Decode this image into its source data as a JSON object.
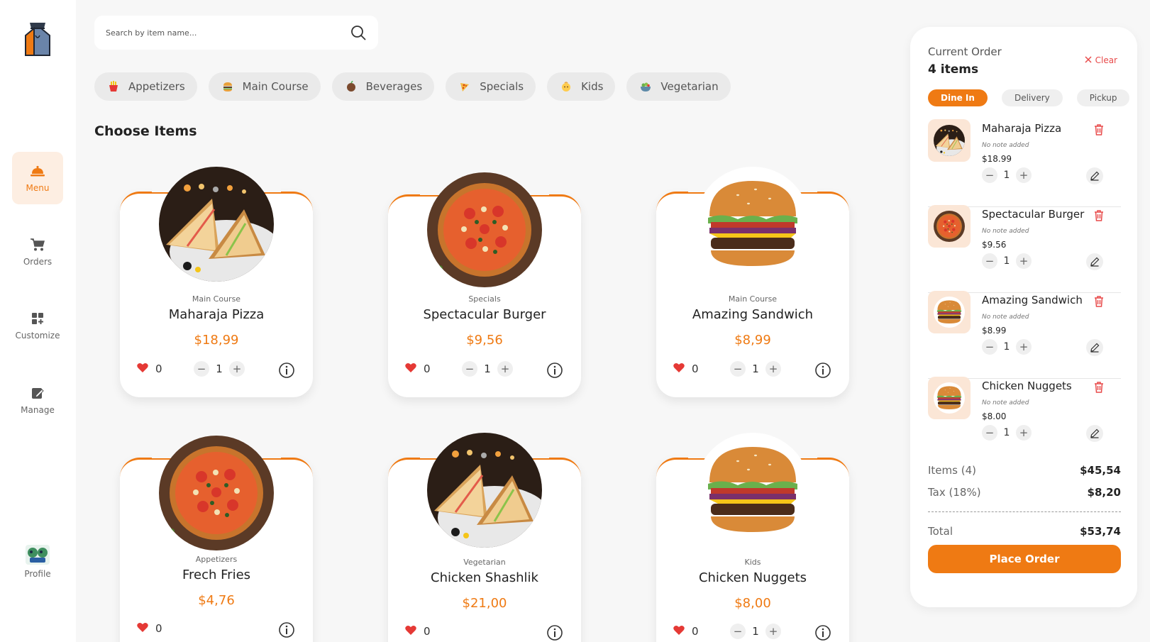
{
  "colors": {
    "accent": "#ef7a13",
    "danger": "#e84a4a",
    "heart": "#e53935",
    "page_bg": "#f7f7f7"
  },
  "sidebar": {
    "items": [
      {
        "label": "Menu",
        "icon": "cloche-icon",
        "active": true
      },
      {
        "label": "Orders",
        "icon": "cart-icon",
        "active": false
      },
      {
        "label": "Customize",
        "icon": "grid-plus-icon",
        "active": false
      },
      {
        "label": "Manage",
        "icon": "edit-document-icon",
        "active": false
      },
      {
        "label": "Profile",
        "icon": "avatar-icon",
        "active": false
      }
    ]
  },
  "search": {
    "placeholder": "Search by item name..."
  },
  "categories": [
    {
      "label": "Appetizers",
      "icon": "fries-icon"
    },
    {
      "label": "Main Course",
      "icon": "burger-icon"
    },
    {
      "label": "Beverages",
      "icon": "drink-icon"
    },
    {
      "label": "Specials",
      "icon": "pizza-icon"
    },
    {
      "label": "Kids",
      "icon": "baby-icon"
    },
    {
      "label": "Vegetarian",
      "icon": "salad-icon"
    }
  ],
  "section_title": "Choose Items",
  "items": [
    {
      "category": "Main Course",
      "name": "Maharaja Pizza",
      "price": "$18,99",
      "likes": "0",
      "qty": "1",
      "image": "sandwich"
    },
    {
      "category": "Specials",
      "name": "Spectacular Burger",
      "price": "$9,56",
      "likes": "0",
      "qty": "1",
      "image": "pizza"
    },
    {
      "category": "Main Course",
      "name": "Amazing Sandwich",
      "price": "$8,99",
      "likes": "0",
      "qty": "1",
      "image": "burger"
    },
    {
      "category": "Appetizers",
      "name": "Frech Fries",
      "price": "$4,76",
      "likes": "0",
      "qty": "",
      "image": "pizza"
    },
    {
      "category": "Vegetarian",
      "name": "Chicken Shashlik",
      "price": "$21,00",
      "likes": "0",
      "qty": "",
      "image": "sandwich"
    },
    {
      "category": "Kids",
      "name": "Chicken Nuggets",
      "price": "$8,00",
      "likes": "0",
      "qty": "1",
      "image": "burger"
    }
  ],
  "order": {
    "title": "Current Order",
    "count": "4 items",
    "clear_label": "Clear",
    "modes": [
      "Dine In",
      "Delivery",
      "Pickup"
    ],
    "active_mode": "Dine In",
    "lines": [
      {
        "name": "Maharaja Pizza",
        "note": "No note added",
        "price": "$18.99",
        "qty": "1",
        "image": "sandwich"
      },
      {
        "name": "Spectacular Burger",
        "note": "No note added",
        "price": "$9.56",
        "qty": "1",
        "image": "pizza"
      },
      {
        "name": "Amazing Sandwich",
        "note": "No note added",
        "price": "$8.99",
        "qty": "1",
        "image": "burger"
      },
      {
        "name": "Chicken Nuggets",
        "note": "No note added",
        "price": "$8.00",
        "qty": "1",
        "image": "burger"
      }
    ],
    "summary": {
      "items_label": "Items (4)",
      "items_value": "$45,54",
      "tax_label": "Tax (18%)",
      "tax_value": "$8,20",
      "total_label": "Total",
      "total_value": "$53,74"
    },
    "place_label": "Place Order"
  }
}
